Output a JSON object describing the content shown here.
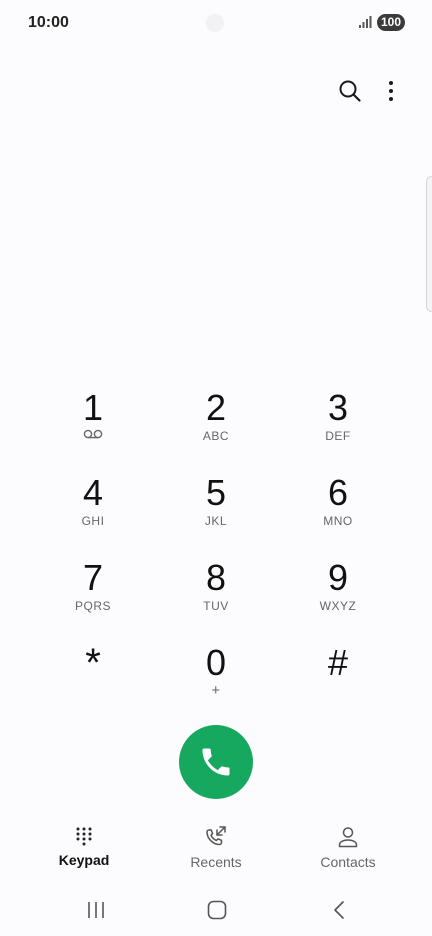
{
  "status_bar": {
    "time": "10:00",
    "battery": "100",
    "icons": [
      "signal-icon",
      "battery-icon"
    ]
  },
  "top_actions": {
    "icons": [
      "search-icon",
      "more-vertical-icon"
    ]
  },
  "keypad": {
    "keys": [
      {
        "digit": "1",
        "letters": "",
        "icon": "voicemail-icon"
      },
      {
        "digit": "2",
        "letters": "ABC"
      },
      {
        "digit": "3",
        "letters": "DEF"
      },
      {
        "digit": "4",
        "letters": "GHI"
      },
      {
        "digit": "5",
        "letters": "JKL"
      },
      {
        "digit": "6",
        "letters": "MNO"
      },
      {
        "digit": "7",
        "letters": "PQRS"
      },
      {
        "digit": "8",
        "letters": "TUV"
      },
      {
        "digit": "9",
        "letters": "WXYZ"
      },
      {
        "digit": "*",
        "letters": ""
      },
      {
        "digit": "0",
        "letters": "+"
      },
      {
        "digit": "#",
        "letters": ""
      }
    ]
  },
  "call": {
    "icon": "phone-icon",
    "color": "#17a860"
  },
  "bottom_nav": {
    "tabs": [
      {
        "label": "Keypad",
        "icon": "keypad-icon",
        "active": true
      },
      {
        "label": "Recents",
        "icon": "recents-icon",
        "active": false
      },
      {
        "label": "Contacts",
        "icon": "contacts-icon",
        "active": false
      }
    ]
  },
  "system_nav": {
    "icons": [
      "recent-apps-icon",
      "home-icon",
      "back-icon"
    ]
  }
}
